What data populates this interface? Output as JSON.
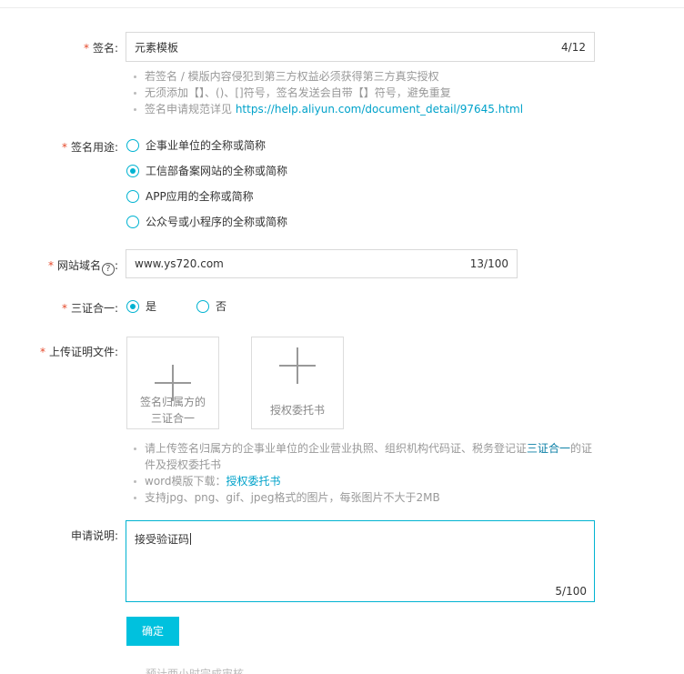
{
  "signature": {
    "label": "签名",
    "value": "元素模板",
    "count": "4/12",
    "hints": [
      "若签名 / 模版内容侵犯到第三方权益必须获得第三方真实授权",
      "无须添加【】、()、[]符号，签名发送会自带【】符号，避免重复"
    ],
    "hint3_prefix": "签名申请规范详见 ",
    "hint3_link": "https://help.aliyun.com/document_detail/97645.html"
  },
  "usage": {
    "label": "签名用途",
    "options": [
      {
        "label": "企事业单位的全称或简称",
        "checked": false
      },
      {
        "label": "工信部备案网站的全称或简称",
        "checked": true
      },
      {
        "label": "APP应用的全称或简称",
        "checked": false
      },
      {
        "label": "公众号或小程序的全称或简称",
        "checked": false
      }
    ]
  },
  "domain": {
    "label": "网站域名",
    "help_icon": "?",
    "value": "www.ys720.com",
    "count": "13/100"
  },
  "three_in_one": {
    "label": "三证合一",
    "options": [
      {
        "label": "是",
        "checked": true
      },
      {
        "label": "否",
        "checked": false
      }
    ]
  },
  "upload": {
    "label": "上传证明文件",
    "boxes": [
      {
        "line1": "签名归属方的",
        "line2": "三证合一"
      },
      {
        "line1": "授权委托书",
        "line2": ""
      }
    ],
    "hint1_a": "请上传签名归属方的企事业单位的企业营业执照、组织机构代码证、税务登记证",
    "hint1_link": "三证合一",
    "hint1_b": "的证",
    "hint1_c": "件及授权委托书",
    "hint2_prefix": "word模版下载：",
    "hint2_link": "授权委托书",
    "hint3": "支持jpg、png、gif、jpeg格式的图片，每张图片不大于2MB"
  },
  "description": {
    "label": "申请说明",
    "value": "接受验证码",
    "count": "5/100"
  },
  "submit_label": "确定",
  "footer_cut": "预计两小时完成审核",
  "colors": {
    "accent": "#00c1de",
    "required": "#e5492b",
    "link": "#00a2ca"
  }
}
